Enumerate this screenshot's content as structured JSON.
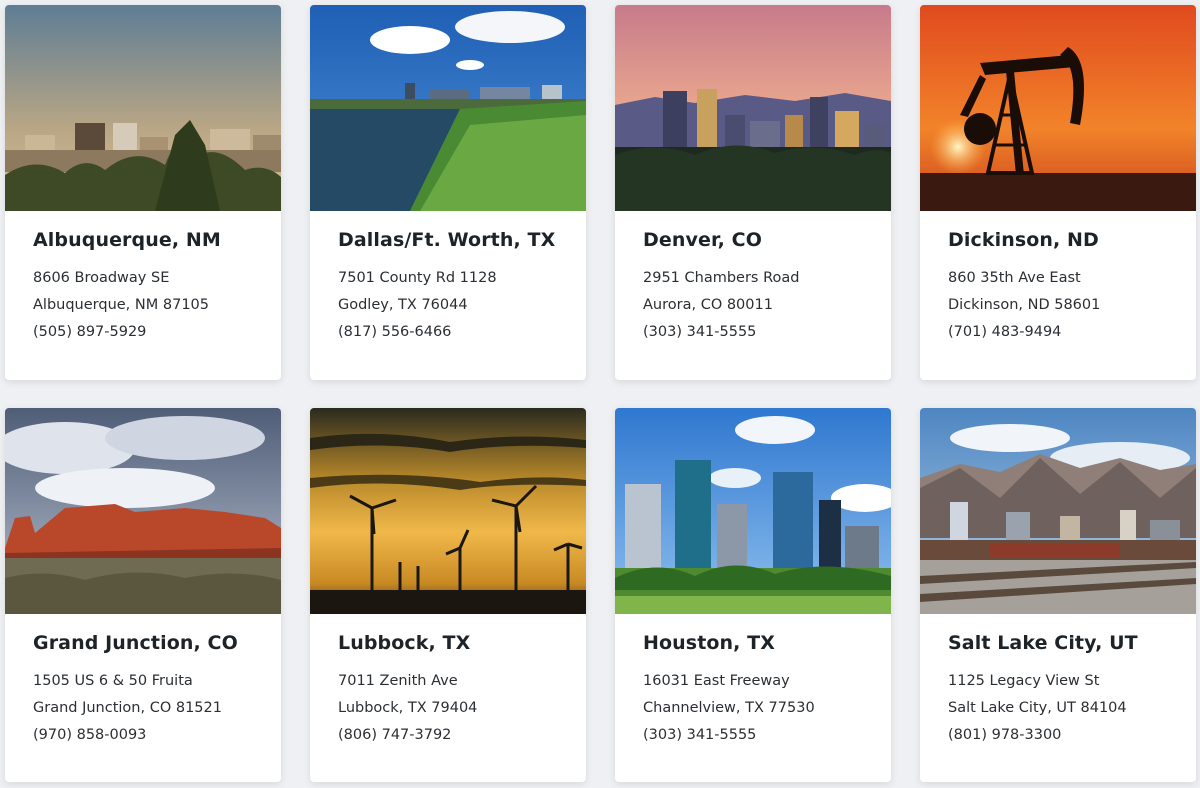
{
  "locations": [
    {
      "city": "Albuquerque, NM",
      "address": "8606 Broadway SE",
      "city_state_zip": "Albuquerque, NM 87105",
      "phone": "(505) 897-5929"
    },
    {
      "city": "Dallas/Ft. Worth, TX",
      "address": "7501 County Rd 1128",
      "city_state_zip": "Godley, TX 76044",
      "phone": "(817) 556-6466"
    },
    {
      "city": "Denver, CO",
      "address": "2951 Chambers Road",
      "city_state_zip": "Aurora, CO 80011",
      "phone": "(303) 341-5555"
    },
    {
      "city": "Dickinson, ND",
      "address": "860 35th Ave East",
      "city_state_zip": "Dickinson, ND 58601",
      "phone": "(701) 483-9494"
    },
    {
      "city": "Grand Junction, CO",
      "address": "1505 US 6 & 50 Fruita",
      "city_state_zip": "Grand Junction, CO 81521",
      "phone": "(970) 858-0093"
    },
    {
      "city": "Lubbock, TX",
      "address": "7011 Zenith Ave",
      "city_state_zip": "Lubbock, TX 79404",
      "phone": "(806) 747-3792"
    },
    {
      "city": "Houston, TX",
      "address": "16031 East Freeway",
      "city_state_zip": "Channelview, TX 77530",
      "phone": "(303) 341-5555"
    },
    {
      "city": "Salt Lake City, UT",
      "address": "1125 Legacy View St",
      "city_state_zip": "Salt Lake City, UT 84104",
      "phone": "(801) 978-3300"
    }
  ]
}
